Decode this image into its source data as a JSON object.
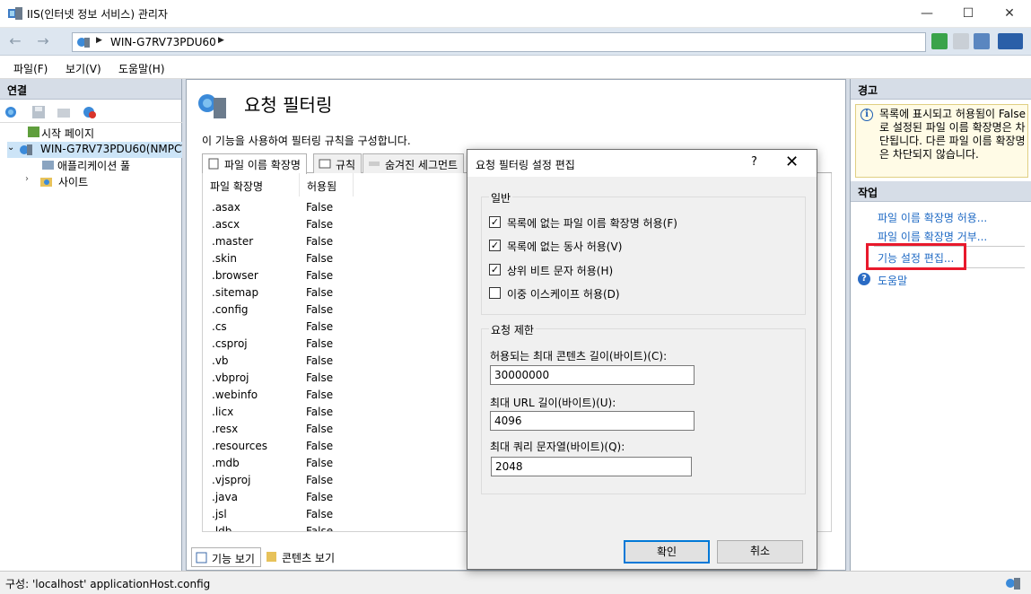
{
  "window": {
    "title": "IIS(인터넷 정보 서비스) 관리자",
    "minimize": "—",
    "maximize": "☐",
    "close": "✕"
  },
  "address": {
    "back": "←",
    "forward": "→",
    "crumb": "WIN-G7RV73PDU60",
    "separator": "▶"
  },
  "menu": {
    "file": "파일(F)",
    "view": "보기(V)",
    "help": "도움말(H)"
  },
  "connections": {
    "header": "연결",
    "tree": {
      "start_page": "시작 페이지",
      "server": "WIN-G7RV73PDU60(NMPC\\",
      "app_pools": "애플리케이션 풀",
      "sites": "사이트"
    }
  },
  "main": {
    "title": "요청 필터링",
    "description": "이 기능을 사용하여 필터링 규칙을 구성합니다.",
    "tabs": [
      "파일 이름 확장명",
      "규칙",
      "숨겨진 세그먼트"
    ],
    "columns": [
      "파일 확장명",
      "허용됨"
    ],
    "rows": [
      {
        "ext": ".asax",
        "allowed": "False"
      },
      {
        "ext": ".ascx",
        "allowed": "False"
      },
      {
        "ext": ".master",
        "allowed": "False"
      },
      {
        "ext": ".skin",
        "allowed": "False"
      },
      {
        "ext": ".browser",
        "allowed": "False"
      },
      {
        "ext": ".sitemap",
        "allowed": "False"
      },
      {
        "ext": ".config",
        "allowed": "False"
      },
      {
        "ext": ".cs",
        "allowed": "False"
      },
      {
        "ext": ".csproj",
        "allowed": "False"
      },
      {
        "ext": ".vb",
        "allowed": "False"
      },
      {
        "ext": ".vbproj",
        "allowed": "False"
      },
      {
        "ext": ".webinfo",
        "allowed": "False"
      },
      {
        "ext": ".licx",
        "allowed": "False"
      },
      {
        "ext": ".resx",
        "allowed": "False"
      },
      {
        "ext": ".resources",
        "allowed": "False"
      },
      {
        "ext": ".mdb",
        "allowed": "False"
      },
      {
        "ext": ".vjsproj",
        "allowed": "False"
      },
      {
        "ext": ".java",
        "allowed": "False"
      },
      {
        "ext": ".jsl",
        "allowed": "False"
      },
      {
        "ext": ".ldb",
        "allowed": "False"
      }
    ],
    "bottom_tabs": [
      "기능 보기",
      "콘텐츠 보기"
    ]
  },
  "actions": {
    "alerts_header": "경고",
    "alert_text": "목록에 표시되고 허용됨이 False로 설정된 파일 이름 확장명은 차단됩니다. 다른 파일 이름 확장명은 차단되지 않습니다.",
    "actions_header": "작업",
    "links": [
      "파일 이름 확장명 허용...",
      "파일 이름 확장명 거부...",
      "기능 설정 편집...",
      "도움말"
    ]
  },
  "status": {
    "text": "구성: 'localhost' applicationHost.config"
  },
  "dialog": {
    "title": "요청 필터링 설정 편집",
    "help": "?",
    "close": "✕",
    "general_group": "일반",
    "checkboxes": [
      {
        "label": "목록에 없는 파일 이름 확장명 허용(F)",
        "checked": true
      },
      {
        "label": "목록에 없는 동사 허용(V)",
        "checked": true
      },
      {
        "label": "상위 비트 문자 허용(H)",
        "checked": true
      },
      {
        "label": "이중 이스케이프 허용(D)",
        "checked": false
      }
    ],
    "limits_group": "요청 제한",
    "max_content_label": "허용되는 최대 콘텐츠 길이(바이트)(C):",
    "max_content_value": "30000000",
    "max_url_label": "최대 URL 길이(바이트)(U):",
    "max_url_value": "4096",
    "max_query_label": "최대 쿼리 문자열(바이트)(Q):",
    "max_query_value": "2048",
    "ok": "확인",
    "cancel": "취소"
  },
  "colors": {
    "accent_link": "#1e69c4",
    "highlight_box": "#e8192c",
    "panel_header": "#d6dde7"
  }
}
